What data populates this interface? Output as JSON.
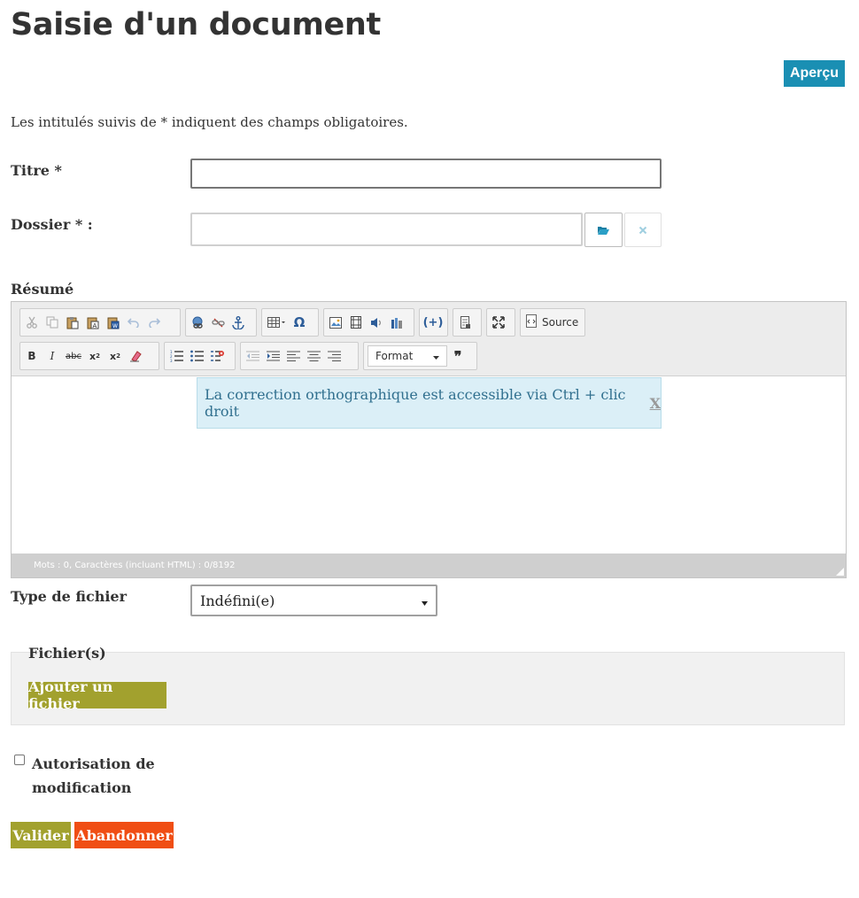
{
  "page": {
    "title": "Saisie d'un document"
  },
  "header": {
    "preview_label": "Aperçu"
  },
  "form": {
    "intro": "Les intitulés suivis de * indiquent des champs obligatoires.",
    "title_label": "Titre *",
    "title_value": "",
    "folder_label": "Dossier * :",
    "folder_value": "",
    "summary_label": "Résumé",
    "file_type_label": "Type de fichier",
    "file_type_value": "Indéfini(e)",
    "files_legend": "Fichier(s)",
    "add_file_label": "Ajouter un fichier",
    "allow_edit_label": "Autorisation de modification",
    "allow_edit_checked": false,
    "submit_label": "Valider",
    "cancel_label": "Abandonner"
  },
  "editor": {
    "source_label": "Source",
    "format_label": "Format",
    "notice_text": "La correction orthographique est accessible via Ctrl + clic droit",
    "notice_close": "X",
    "status_text": "Mots : 0, Caractères (incluant HTML) : 0/8192"
  },
  "colors": {
    "preview_button": "#1a8fb3",
    "primary_button": "#a2a12e",
    "danger_button": "#f04e14",
    "notice_bg": "#dbeff7"
  }
}
